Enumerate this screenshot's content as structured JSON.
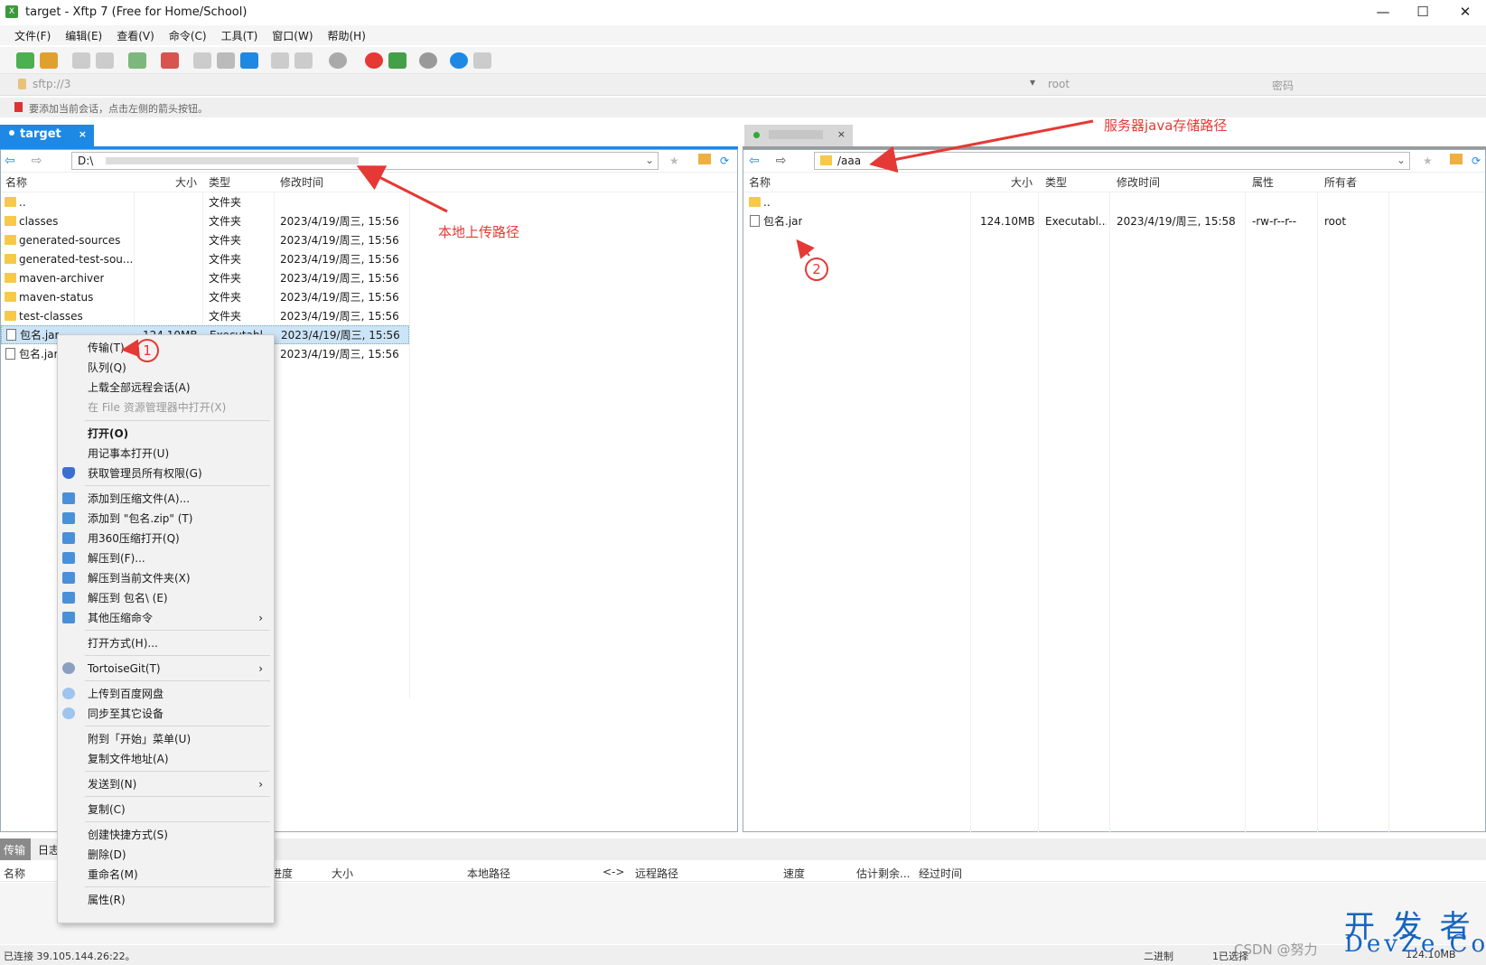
{
  "window": {
    "title": "target - Xftp 7 (Free for Home/School)",
    "min": "—",
    "max": "☐",
    "close": "✕"
  },
  "menu": [
    "文件(F)",
    "编辑(E)",
    "查看(V)",
    "命令(C)",
    "工具(T)",
    "窗口(W)",
    "帮助(H)"
  ],
  "address": {
    "url": "sftp://3",
    "user": "root",
    "password": "密码"
  },
  "hint": "要添加当前会话，点击左侧的箭头按钮。",
  "tabs": {
    "local": "target",
    "local_close": "×",
    "remote_close": "×"
  },
  "local": {
    "path": "D:\\",
    "columns": {
      "name": "名称",
      "size": "大小",
      "type": "类型",
      "modified": "修改时间"
    },
    "rows": [
      {
        "name": "..",
        "size": "",
        "type": "文件夹",
        "modified": "",
        "kind": "folder"
      },
      {
        "name": "classes",
        "size": "",
        "type": "文件夹",
        "modified": "2023/4/19/周三, 15:56",
        "kind": "folder"
      },
      {
        "name": "generated-sources",
        "size": "",
        "type": "文件夹",
        "modified": "2023/4/19/周三, 15:56",
        "kind": "folder"
      },
      {
        "name": "generated-test-sou...",
        "size": "",
        "type": "文件夹",
        "modified": "2023/4/19/周三, 15:56",
        "kind": "folder"
      },
      {
        "name": "maven-archiver",
        "size": "",
        "type": "文件夹",
        "modified": "2023/4/19/周三, 15:56",
        "kind": "folder"
      },
      {
        "name": "maven-status",
        "size": "",
        "type": "文件夹",
        "modified": "2023/4/19/周三, 15:56",
        "kind": "folder"
      },
      {
        "name": "test-classes",
        "size": "",
        "type": "文件夹",
        "modified": "2023/4/19/周三, 15:56",
        "kind": "folder"
      },
      {
        "name": "包名.jar",
        "size": "124.10MB",
        "type": "Executabl...",
        "modified": "2023/4/19/周三, 15:56",
        "kind": "file"
      },
      {
        "name": "包名.jar",
        "size": "",
        "type": "",
        "modified": "2023/4/19/周三, 15:56",
        "kind": "file"
      }
    ]
  },
  "remote": {
    "path": "/aaa",
    "columns": {
      "name": "名称",
      "size": "大小",
      "type": "类型",
      "modified": "修改时间",
      "attr": "属性",
      "owner": "所有者"
    },
    "rows": [
      {
        "name": "..",
        "size": "",
        "type": "",
        "modified": "",
        "attr": "",
        "owner": "",
        "kind": "folder"
      },
      {
        "name": "包名.jar",
        "size": "124.10MB",
        "type": "Executabl...",
        "modified": "2023/4/19/周三, 15:58",
        "attr": "-rw-r--r--",
        "owner": "root",
        "kind": "file"
      }
    ]
  },
  "context_menu": [
    {
      "label": "传输(T)"
    },
    {
      "label": "队列(Q)"
    },
    {
      "label": "上载全部远程会话(A)"
    },
    {
      "label": "在 File 资源管理器中打开(X)",
      "disabled": true
    },
    {
      "label": "打开(O)",
      "bold": true
    },
    {
      "label": "用记事本打开(U)"
    },
    {
      "label": "获取管理员所有权限(G)",
      "icon": "shield-icon"
    },
    {
      "label": "添加到压缩文件(A)...",
      "icon": "archive-icon"
    },
    {
      "label": "添加到 \"包名.zip\" (T)",
      "icon": "archive-icon"
    },
    {
      "label": "用360压缩打开(Q)",
      "icon": "archive-icon"
    },
    {
      "label": "解压到(F)...",
      "icon": "archive-icon"
    },
    {
      "label": "解压到当前文件夹(X)",
      "icon": "archive-icon"
    },
    {
      "label": "解压到 包名\\ (E)",
      "icon": "archive-icon"
    },
    {
      "label": "其他压缩命令",
      "icon": "archive-icon",
      "submenu": true
    },
    {
      "label": "打开方式(H)..."
    },
    {
      "label": "TortoiseGit(T)",
      "icon": "git-icon",
      "submenu": true
    },
    {
      "label": "上传到百度网盘",
      "icon": "cloud-icon"
    },
    {
      "label": "同步至其它设备",
      "icon": "cloud-icon"
    },
    {
      "label": "附到「开始」菜单(U)"
    },
    {
      "label": "复制文件地址(A)"
    },
    {
      "label": "发送到(N)",
      "submenu": true
    },
    {
      "label": "复制(C)"
    },
    {
      "label": "创建快捷方式(S)"
    },
    {
      "label": "删除(D)"
    },
    {
      "label": "重命名(M)"
    },
    {
      "label": "属性(R)"
    }
  ],
  "submenu_arrow": "›",
  "bottom": {
    "tabs": [
      "传输",
      "日志"
    ],
    "columns": [
      "名称",
      "进度",
      "大小",
      "本地路径",
      "<->",
      "远程路径",
      "速度",
      "估计剩余...",
      "经过时间"
    ]
  },
  "status": {
    "connected": "已连接 39.105.144.26:22。",
    "mode": "二进制",
    "selected": "1已选择",
    "size": "124.10MB"
  },
  "annotations": {
    "local_path": "本地上传路径",
    "server_path": "服务器java存储路径",
    "step1": "1",
    "step2": "2"
  },
  "watermark": {
    "brand_cn": "开 发 者",
    "brand_en": "DevZe.CoM",
    "csdn": "CSDN @努力"
  },
  "colors": {
    "accent": "#1e88e5",
    "annotation": "#e53935",
    "folder": "#f6c94a"
  }
}
